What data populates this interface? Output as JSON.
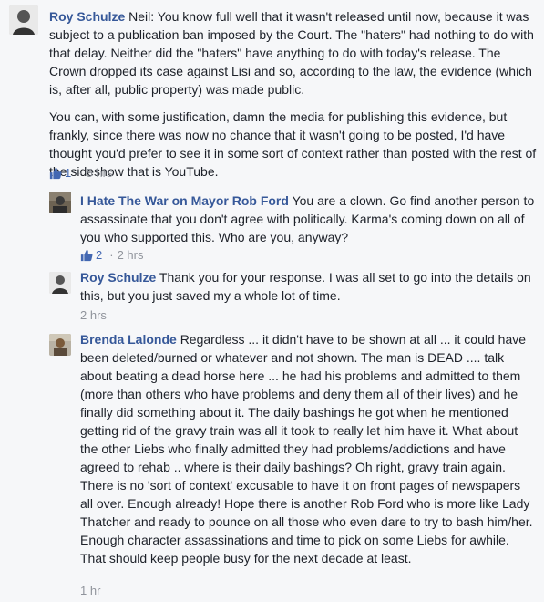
{
  "comments": [
    {
      "author": "Roy Schulze",
      "text_para1": "Neil: You know full well that it wasn't released until now, because it was subject to a publication ban imposed by the Court. The \"haters\" had nothing to do with that delay. Neither did the \"haters\" have anything to do with today's release. The Crown dropped its case against Lisi and so, according to the law, the evidence (which is, after all, public property) was made public.",
      "text_para2": "You can, with some justification, damn the media for publishing this evidence, but frankly, since there was now no chance that it wasn't going to be posted, I'd have thought you'd prefer to see it in some sort of context rather than posted with the rest of the sideshow that is YouTube.",
      "likes": "1",
      "time": "5 hrs"
    },
    {
      "author": "I Hate The War on Mayor Rob Ford",
      "text": "You are a clown. Go find another person to assassinate that you don't agree with politically. Karma's coming down on all of you who supported this. Who are you, anyway?",
      "likes": "2",
      "time": "2 hrs"
    },
    {
      "author": "Roy Schulze",
      "text": "Thank you for your response. I was all set to go into the details on this, but you just saved my a whole lot of time.",
      "time": "2 hrs"
    },
    {
      "author": "Brenda Lalonde",
      "text": "Regardless ... it didn't have to be shown at all ... it could have been deleted/burned or whatever and not shown. The man is DEAD .... talk about beating a dead horse here ... he had his problems and admitted to them (more than others who have problems and deny them all of their lives) and he finally did something about it. The daily bashings he got when he mentioned getting rid of the gravy train was all it took to really let him have it. What about the other Liebs who finally admitted they had problems/addictions and have agreed to rehab .. where is their daily bashings? Oh right, gravy train again. There is no 'sort of context' excusable to have it on front pages of newspapers all over. Enough already! Hope there is another Rob Ford who is more like Lady Thatcher and ready to pounce on all those who even dare to try to bash him/her. Enough character assassinations and time to pick on some Liebs for awhile. That should keep people busy for the next decade at least.",
      "time": "1 hr"
    }
  ],
  "meta": {
    "separator": "·"
  },
  "colors": {
    "name": "#365899",
    "meta": "#90949c",
    "like": "#4267b2",
    "background": "#f6f7f9"
  },
  "icons": {
    "like": "thumbs-up-icon"
  }
}
